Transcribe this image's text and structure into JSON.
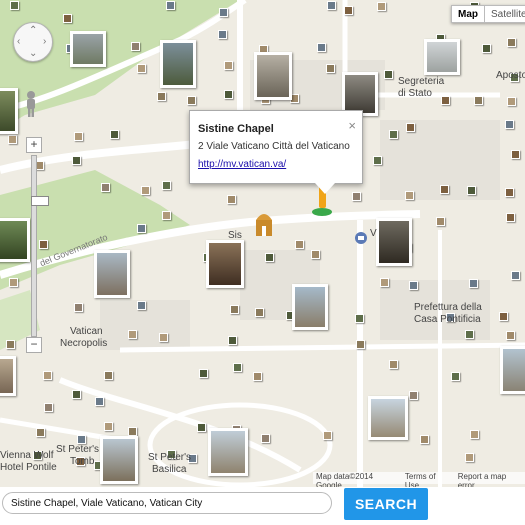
{
  "map_type": {
    "map_label": "Map",
    "satellite_label": "Satellite",
    "selected": "Map"
  },
  "labels": {
    "segreteria": "Segreteria",
    "stato": "di Stato",
    "apostolic": "Aposto",
    "governatorato": "del Governatorato",
    "sis": "Sis",
    "vatican_necropolis_1": "Vatican",
    "vatican_necropolis_2": "Necropolis",
    "prefettura_1": "Prefettura della",
    "prefettura_2": "Casa Pontificia",
    "vienna_1": "Vienna Wolf",
    "vienna_2": "Hotel Pontile",
    "st_peters_tomb_1": "St Peter's",
    "st_peters_tomb_2": "Tomb",
    "st_peters_basilica_1": "St Peter's",
    "st_peters_basilica_2": "Basilica",
    "v_label": "V"
  },
  "info_window": {
    "title": "Sistine Chapel",
    "address": "2 Viale Vaticano Città del Vaticano",
    "link": "http://mv.vatican.va/",
    "close": "×"
  },
  "attribution": {
    "map_data": "Map data©2014 Google",
    "terms": "Terms of Use",
    "report": "Report a map error"
  },
  "search": {
    "value": "Sistine Chapel, Viale Vaticano, Vatican City",
    "button": "SEARCH"
  },
  "colors": {
    "map_bg": "#efece3",
    "park": "#c9dfaf",
    "road": "#ffffff",
    "button": "#2196e8"
  },
  "icons": {
    "pan": "pan-control-icon",
    "pegman": "street-view-pegman-icon",
    "info_marker": "info-marker-icon",
    "church": "church-icon",
    "post": "post-office-icon"
  }
}
